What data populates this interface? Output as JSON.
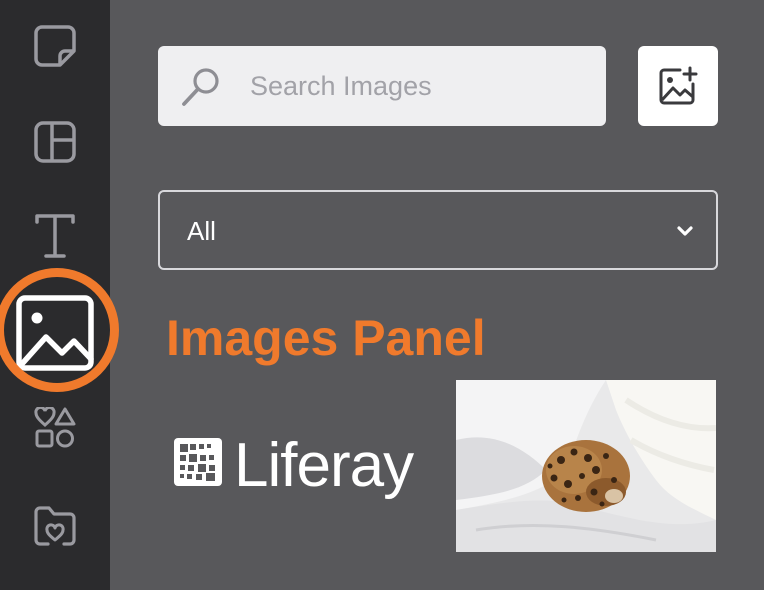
{
  "sidebar": {
    "items": [
      {
        "name": "sticky-note-icon"
      },
      {
        "name": "layout-icon"
      },
      {
        "name": "text-icon"
      },
      {
        "name": "image-icon",
        "active": true
      },
      {
        "name": "shapes-icon"
      },
      {
        "name": "folder-favorites-icon"
      }
    ],
    "active_color": "#f07a2c"
  },
  "search": {
    "placeholder": "Search Images"
  },
  "add_image_button": {
    "icon": "add-image-icon"
  },
  "filter": {
    "selected": "All"
  },
  "panel_title": "Images Panel",
  "images": [
    {
      "name": "liferay-logo",
      "logo_text": "Liferay"
    },
    {
      "name": "cat-photo"
    }
  ],
  "colors": {
    "accent": "#f07a2c",
    "rail_bg": "#2b2b2d",
    "panel_bg": "#58585b"
  }
}
